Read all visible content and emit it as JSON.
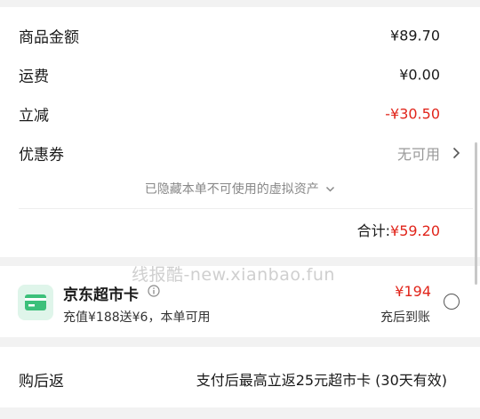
{
  "summary": {
    "rows": [
      {
        "label": "商品金额",
        "value": "¥89.70"
      },
      {
        "label": "运费",
        "value": "¥0.00"
      },
      {
        "label": "立减",
        "value": "-¥30.50"
      },
      {
        "label": "优惠券",
        "value": "无可用"
      }
    ],
    "hidden_note": "已隐藏本单不可使用的虚拟资产",
    "total_label": "合计:",
    "total_value": "¥59.20"
  },
  "watermark": "线报酷-new.xianbao.fun",
  "supermarket_card": {
    "title": "京东超市卡",
    "subtitle": "充值¥188送¥6，本单可用",
    "price": "¥194",
    "note": "充后到账",
    "icon": "card-icon",
    "icon_color": "#3cc07a"
  },
  "rebate": {
    "label": "购后返",
    "text": "支付后最高立返25元超市卡 (30天有效)"
  },
  "colors": {
    "accent_red": "#e1251b",
    "muted": "#999999"
  }
}
